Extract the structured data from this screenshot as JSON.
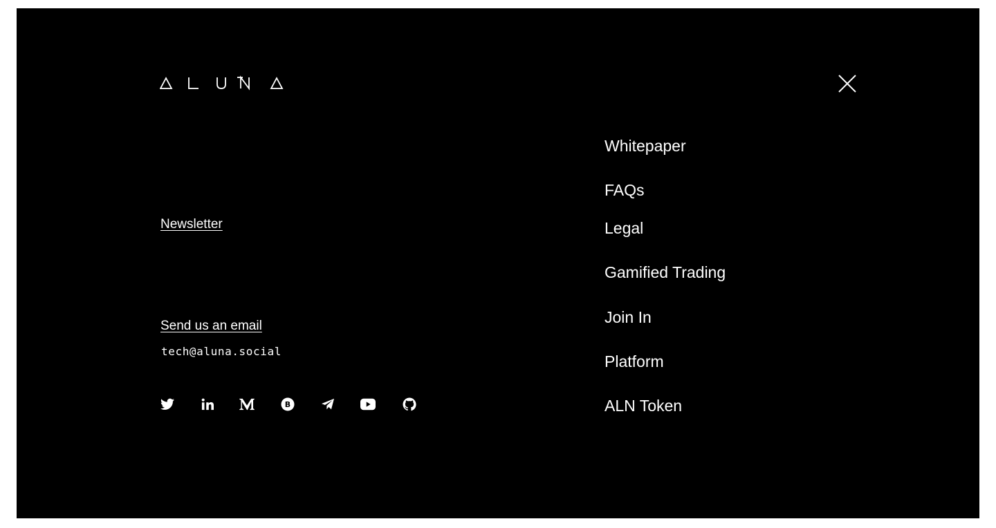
{
  "brand": {
    "logo_text": "ALUNA"
  },
  "close": {
    "icon": "close-icon"
  },
  "left": {
    "newsletter_label": "Newsletter",
    "send_email_label": "Send us an email",
    "email_address": "tech@aluna.social"
  },
  "social": [
    {
      "name": "twitter",
      "icon": "twitter-icon"
    },
    {
      "name": "linkedin",
      "icon": "linkedin-icon"
    },
    {
      "name": "medium",
      "icon": "medium-icon"
    },
    {
      "name": "bitcointalk",
      "icon": "bitcoin-icon"
    },
    {
      "name": "telegram",
      "icon": "telegram-icon"
    },
    {
      "name": "youtube",
      "icon": "youtube-icon"
    },
    {
      "name": "github",
      "icon": "github-icon"
    }
  ],
  "nav": {
    "items": [
      {
        "label": "Whitepaper"
      },
      {
        "label": "FAQs"
      },
      {
        "label": "Legal"
      },
      {
        "label": "Gamified Trading"
      },
      {
        "label": "Join In"
      },
      {
        "label": "Platform"
      },
      {
        "label": "ALN Token"
      }
    ]
  },
  "colors": {
    "background": "#000000",
    "text": "#ffffff",
    "page": "#ffffff"
  }
}
